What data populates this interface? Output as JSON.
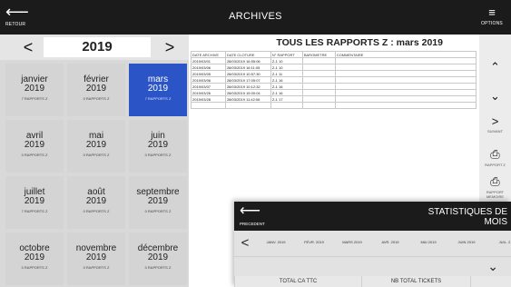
{
  "topbar": {
    "back_glyph": "⟵",
    "back_label": "RETOUR",
    "title": "ARCHIVES",
    "options_glyph": "≡",
    "options_label": "OPTIONS"
  },
  "calendar": {
    "prev_glyph": "<",
    "next_glyph": ">",
    "year": "2019",
    "months": [
      {
        "name": "janvier",
        "year": "2019",
        "reports": "7 RAPPORTS Z",
        "active": false
      },
      {
        "name": "février",
        "year": "2019",
        "reports": "0 RAPPORTS Z",
        "active": false
      },
      {
        "name": "mars",
        "year": "2019",
        "reports": "7 RAPPORTS Z",
        "active": true
      },
      {
        "name": "avril",
        "year": "2019",
        "reports": "0 RAPPORTS Z",
        "active": false
      },
      {
        "name": "mai",
        "year": "2019",
        "reports": "0 RAPPORTS Z",
        "active": false
      },
      {
        "name": "juin",
        "year": "2019",
        "reports": "0 RAPPORTS Z",
        "active": false
      },
      {
        "name": "juillet",
        "year": "2019",
        "reports": "7 RAPPORTS Z",
        "active": false
      },
      {
        "name": "août",
        "year": "2019",
        "reports": "0 RAPPORTS Z",
        "active": false
      },
      {
        "name": "septembre",
        "year": "2019",
        "reports": "0 RAPPORTS Z",
        "active": false
      },
      {
        "name": "octobre",
        "year": "2019",
        "reports": "0 RAPPORTS Z",
        "active": false
      },
      {
        "name": "novembre",
        "year": "2019",
        "reports": "0 RAPPORTS Z",
        "active": false
      },
      {
        "name": "décembre",
        "year": "2019",
        "reports": "0 RAPPORTS Z",
        "active": false
      }
    ]
  },
  "reports": {
    "title": "TOUS LES RAPPORTS Z : mars 2019",
    "columns": [
      "DATE ARCHIVE",
      "DATE CLOTURE",
      "N° RAPPORT",
      "BAROMETRE",
      "COMMENTAIRE"
    ],
    "rows": [
      [
        "2019/03/01",
        "28/03/2019 16:55:06",
        "Z-1 10",
        "",
        ""
      ],
      [
        "2019/03/06",
        "28/03/2019 16:11:05",
        "Z-1 10",
        "",
        ""
      ],
      [
        "2019/03/05",
        "28/03/2019 10:57:30",
        "Z-1 11",
        "",
        ""
      ],
      [
        "2019/03/06",
        "28/03/2019 17:05:07",
        "Z-1 16",
        "",
        ""
      ],
      [
        "2019/03/07",
        "28/03/2019 10:12:32",
        "Z-1 16",
        "",
        ""
      ],
      [
        "2019/03/26",
        "28/03/2019 15:00:04",
        "Z-1 16",
        "",
        ""
      ],
      [
        "2019/03/28",
        "28/03/2019 11:42:06",
        "Z-1 17",
        "",
        ""
      ],
      [
        "",
        "",
        "",
        "",
        ""
      ]
    ]
  },
  "side": {
    "up": "⌃",
    "down": "⌄",
    "next": ">",
    "next_label": "SUIVANT",
    "report_label": "RAPPORT Z",
    "memory_label": "RAPPORT MEMOIRE"
  },
  "stats": {
    "back_glyph": "⟵",
    "back_label": "PRECEDENT",
    "title": "STATISTIQUES DE MOIS",
    "prev_glyph": "<",
    "months": [
      "JANV. 2019",
      "FÉVR. 2019",
      "MARS 2019",
      "AVR. 2019",
      "MAI 2019",
      "JUIN 2019",
      "JUIL. 2"
    ],
    "chevron": "⌄",
    "columns": [
      "TOTAL CA TTC",
      "NB TOTAL TICKETS"
    ]
  }
}
